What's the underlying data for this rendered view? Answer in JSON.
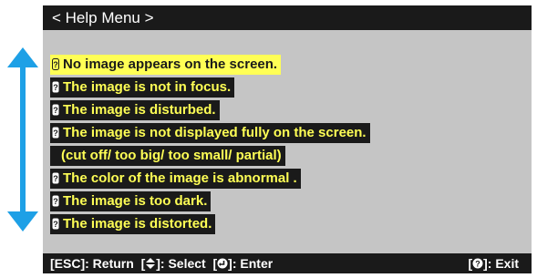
{
  "title": "< Help Menu >",
  "menu_items": [
    {
      "label": "No image appears on the screen.",
      "selected": true
    },
    {
      "label": "The image is not in focus."
    },
    {
      "label": "The image is disturbed."
    },
    {
      "label": "The image is not displayed fully on the screen."
    },
    {
      "sublabel": "(cut off/ too big/ too small/ partial)"
    },
    {
      "label": "The color of the image is abnormal ."
    },
    {
      "label": "The image is too dark."
    },
    {
      "label": "The image is distorted."
    }
  ],
  "footer": {
    "esc_key": "[ESC]",
    "esc_text": ": Return",
    "select_open": "[",
    "select_text": "]: Select",
    "enter_open": "[",
    "enter_text": "]: Enter",
    "exit_open": "[",
    "exit_text": "]: Exit"
  },
  "icons": {
    "scroll": "up-down-arrow-icon",
    "item": "question-icon",
    "select": "up-down-triangle-icon",
    "enter": "enter-icon",
    "exit": "help-icon"
  },
  "colors": {
    "arrow": "#1ea0e6",
    "highlight": "#ffff55",
    "bar": "#1a1a1a",
    "panel": "#c5c5c5"
  }
}
